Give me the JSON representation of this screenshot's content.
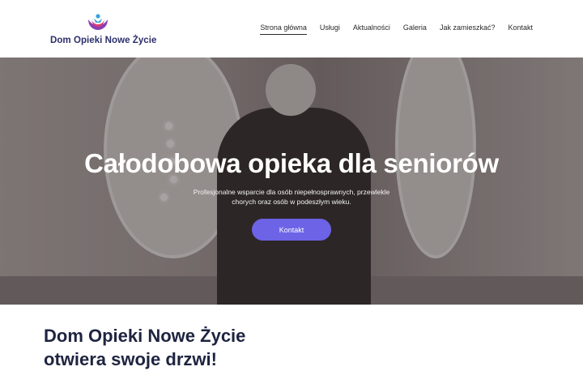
{
  "brand": {
    "name": "Dom Opieki Nowe Życie",
    "logo_icon": "care-hands-logo-icon"
  },
  "nav": {
    "items": [
      "Strona główna",
      "Usługi",
      "Aktualności",
      "Galeria",
      "Jak zamieszkać?",
      "Kontakt"
    ],
    "active": "Strona główna"
  },
  "hero": {
    "title": "Całodobowa opieka dla seniorów",
    "subtitle": "Profesjonalne wsparcie dla osób niepełnosprawnych, przewlekle chorych oraz osób w podeszłym wieku.",
    "button_label": "Kontakt"
  },
  "section": {
    "title_line1": "Dom Opieki Nowe Życie",
    "title_line2": "otwiera swoje drzwi!"
  },
  "colors": {
    "accent": "#6c63e6",
    "brand_text": "#2b2f6b"
  }
}
